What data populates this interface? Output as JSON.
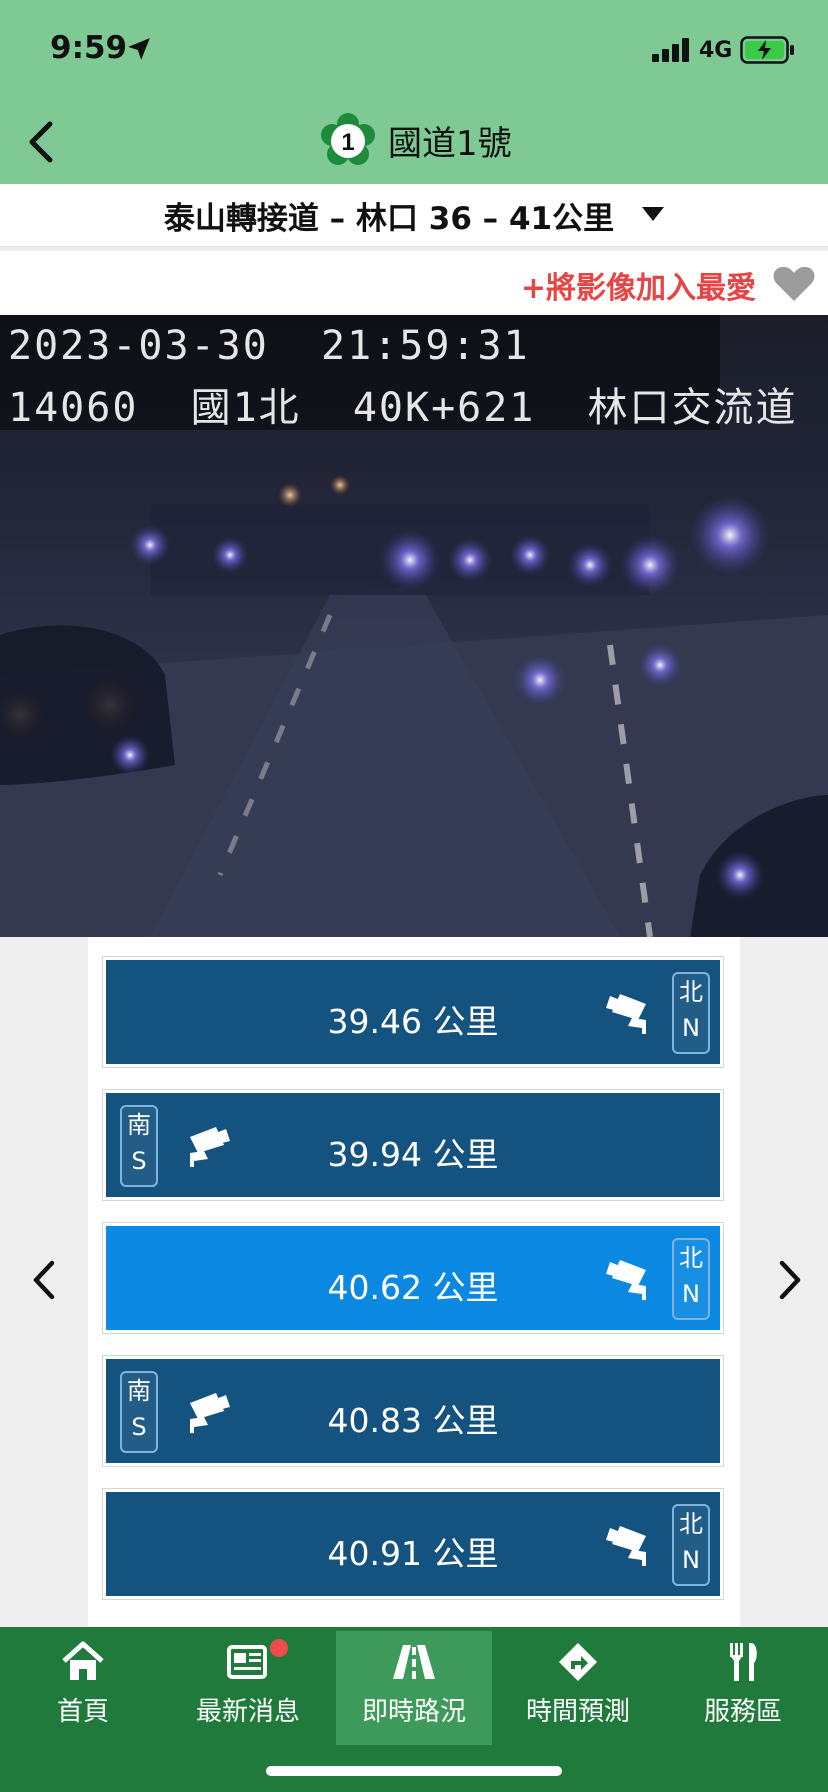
{
  "status_bar": {
    "time": "9:59",
    "network": "4G"
  },
  "nav": {
    "route_number": "1",
    "title": "國道1號"
  },
  "segment": {
    "label": "泰山轉接道 – 林口 36 – 41公里"
  },
  "favorite": {
    "label": "+將影像加入最愛"
  },
  "camera": {
    "line1": "2023-03-30  21:59:31",
    "line2": "14060  國1北  40K+621  林口交流道"
  },
  "cameras": [
    {
      "km": "39.46 公里",
      "dir_zh": "北",
      "dir_en": "N",
      "direction": "north",
      "selected": false
    },
    {
      "km": "39.94 公里",
      "dir_zh": "南",
      "dir_en": "S",
      "direction": "south",
      "selected": false
    },
    {
      "km": "40.62 公里",
      "dir_zh": "北",
      "dir_en": "N",
      "direction": "north",
      "selected": true
    },
    {
      "km": "40.83 公里",
      "dir_zh": "南",
      "dir_en": "S",
      "direction": "south",
      "selected": false
    },
    {
      "km": "40.91 公里",
      "dir_zh": "北",
      "dir_en": "N",
      "direction": "north",
      "selected": false
    }
  ],
  "tabs": [
    {
      "label": "首頁",
      "icon": "home-icon"
    },
    {
      "label": "最新消息",
      "icon": "news-icon"
    },
    {
      "label": "即時路況",
      "icon": "road-icon"
    },
    {
      "label": "時間預測",
      "icon": "route-sign-icon"
    },
    {
      "label": "服務區",
      "icon": "utensils-icon"
    }
  ],
  "colors": {
    "header": "#7fca94",
    "tab_bar": "#1f7a3c",
    "item": "#145380",
    "item_selected": "#0b88e2",
    "favorite": "#e54545"
  }
}
